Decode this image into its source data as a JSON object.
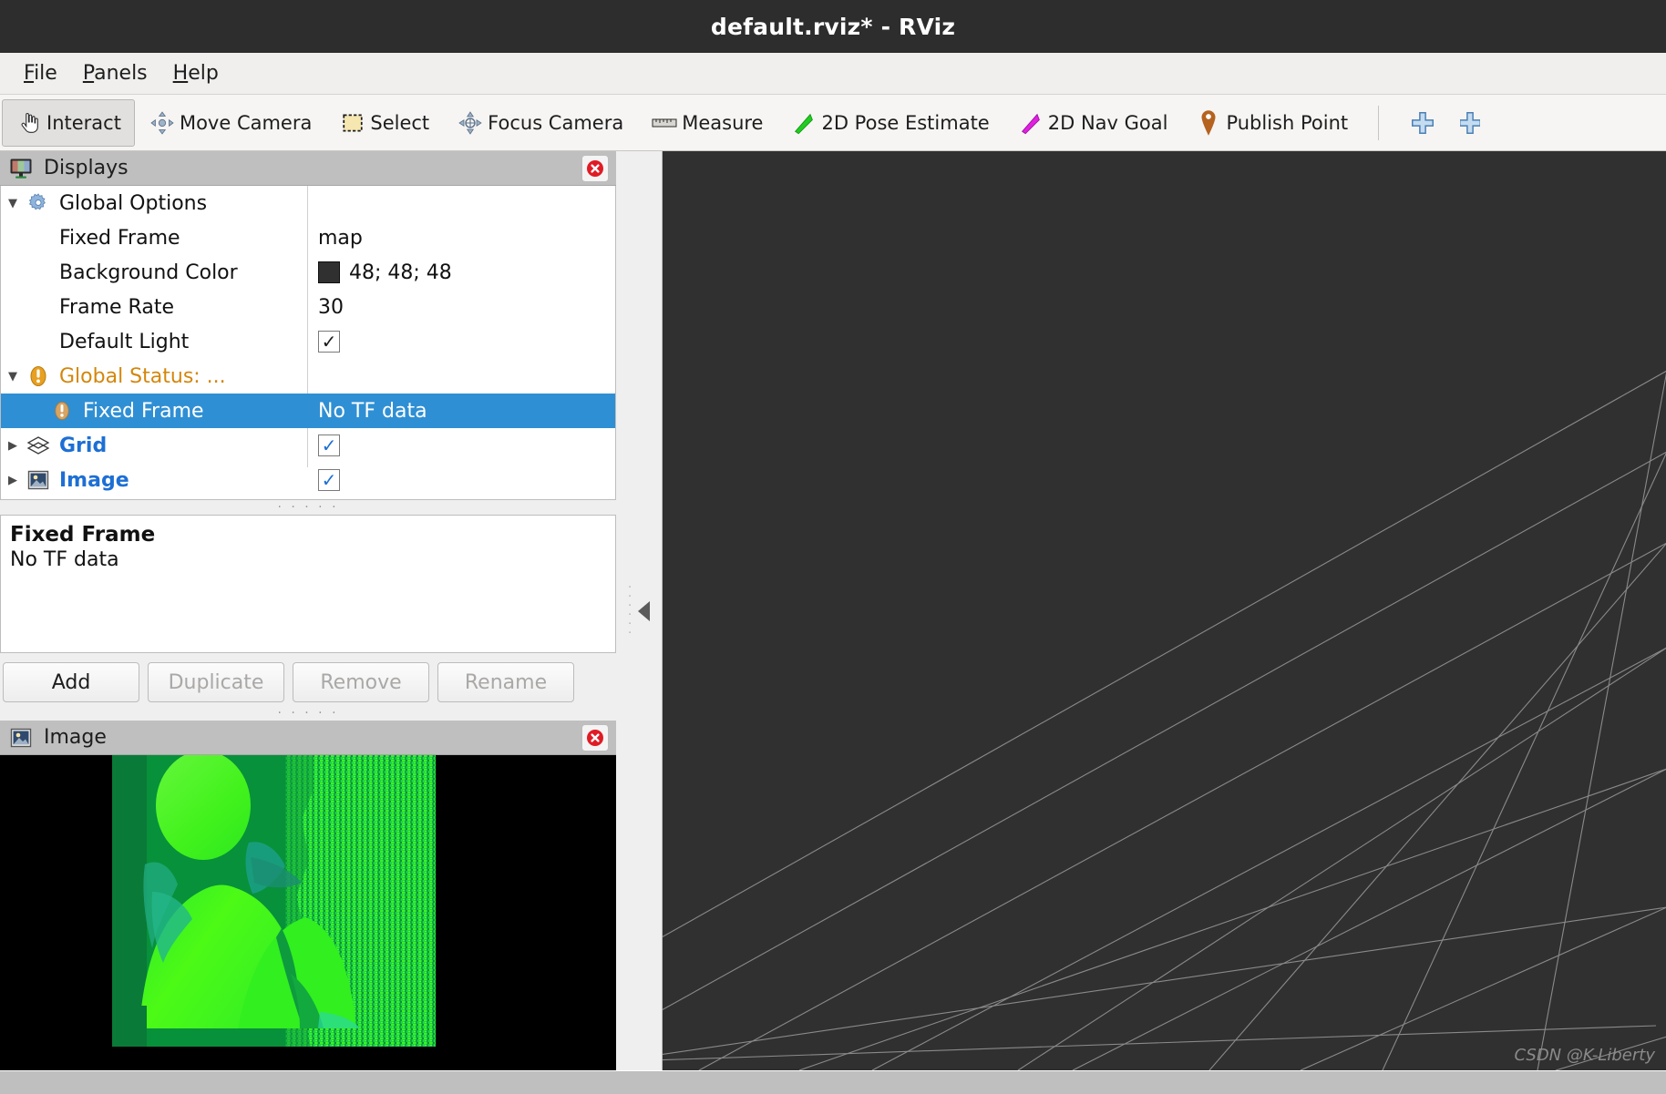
{
  "window": {
    "title": "default.rviz* - RViz",
    "title_bar_color": "#2d2d2d"
  },
  "menubar": {
    "items": [
      {
        "label": "File",
        "mnemonic": "F"
      },
      {
        "label": "Panels",
        "mnemonic": "P"
      },
      {
        "label": "Help",
        "mnemonic": "H"
      }
    ]
  },
  "toolbar": {
    "buttons": [
      {
        "label": "Interact",
        "icon": "hand-cursor-icon",
        "active": true
      },
      {
        "label": "Move Camera",
        "icon": "move-camera-icon",
        "active": false
      },
      {
        "label": "Select",
        "icon": "select-rect-icon",
        "active": false
      },
      {
        "label": "Focus Camera",
        "icon": "focus-camera-icon",
        "active": false
      },
      {
        "label": "Measure",
        "icon": "ruler-icon",
        "active": false
      },
      {
        "label": "2D Pose Estimate",
        "icon": "green-arrow-icon",
        "active": false
      },
      {
        "label": "2D Nav Goal",
        "icon": "magenta-arrow-icon",
        "active": false
      },
      {
        "label": "Publish Point",
        "icon": "map-pin-icon",
        "active": false
      }
    ],
    "add_tool_icon": "plus-icon"
  },
  "displays_panel": {
    "title": "Displays",
    "icon": "displays-monitor-icon",
    "close_icon": "close-icon",
    "tree": [
      {
        "label": "Global Options",
        "value": "",
        "icon": "gear-icon",
        "twisty": "expanded",
        "level": 0,
        "style": "plain"
      },
      {
        "label": "Fixed Frame",
        "value": "map",
        "icon": "",
        "twisty": "none",
        "level": 1,
        "style": "plain"
      },
      {
        "label": "Background Color",
        "value": "48; 48; 48",
        "icon": "",
        "twisty": "none",
        "level": 1,
        "style": "plain",
        "swatch": "#303030"
      },
      {
        "label": "Frame Rate",
        "value": "30",
        "icon": "",
        "twisty": "none",
        "level": 1,
        "style": "plain"
      },
      {
        "label": "Default Light",
        "value": "",
        "icon": "",
        "twisty": "none",
        "level": 1,
        "style": "plain",
        "checkbox": true
      },
      {
        "label": "Global Status: ...",
        "value": "",
        "icon": "warning-icon",
        "twisty": "expanded",
        "level": 0,
        "style": "orange"
      },
      {
        "label": "Fixed Frame",
        "value": "No TF data",
        "icon": "warning-icon",
        "twisty": "none",
        "level": 1,
        "style": "selected"
      },
      {
        "label": "Grid",
        "value": "",
        "icon": "grid-icon",
        "twisty": "collapsed",
        "level": 0,
        "style": "blue",
        "checkbox": true
      },
      {
        "label": "Image",
        "value": "",
        "icon": "picture-icon",
        "twisty": "collapsed",
        "level": 0,
        "style": "blue",
        "checkbox": true
      }
    ],
    "description": {
      "title": "Fixed Frame",
      "body": "No TF data"
    },
    "buttons": [
      {
        "label": "Add",
        "enabled": true
      },
      {
        "label": "Duplicate",
        "enabled": false
      },
      {
        "label": "Remove",
        "enabled": false
      },
      {
        "label": "Rename",
        "enabled": false
      }
    ]
  },
  "image_panel": {
    "title": "Image",
    "icon": "picture-icon",
    "close_icon": "close-icon",
    "content": "depth-camera-image-of-person"
  },
  "view3d": {
    "background_color": "#303030",
    "grid_line_color": "#9a9a9a",
    "watermark": "CSDN @K-Liberty",
    "collapse_arrow_icon": "collapse-left-icon"
  },
  "colors": {
    "selection_blue": "#2f8fd4",
    "link_blue": "#1d6fd4",
    "status_orange": "#d4860b",
    "panel_header_gray": "#bfbfbf"
  }
}
